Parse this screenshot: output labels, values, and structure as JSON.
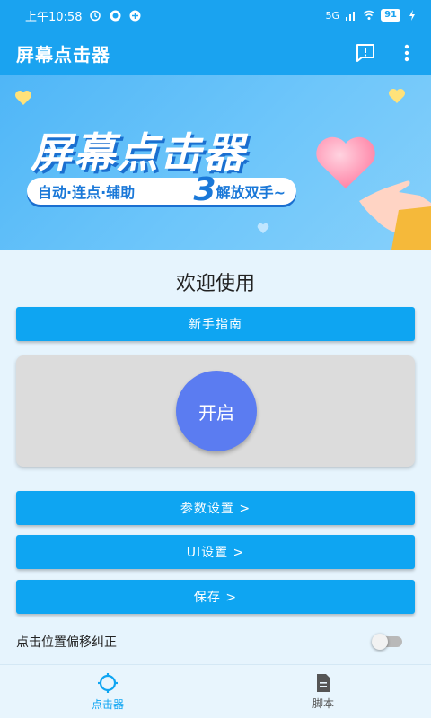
{
  "status_bar": {
    "time": "上午10:58",
    "network": "5G",
    "battery": "91"
  },
  "app_bar": {
    "title": "屏幕点击器"
  },
  "banner": {
    "title": "屏幕点击器",
    "subtitle_left": "自动·连点·辅助",
    "subtitle_num": "3",
    "subtitle_right": "解放双手~"
  },
  "main": {
    "welcome": "欢迎使用",
    "guide_button": "新手指南",
    "start_button": "开启",
    "params_button": "参数设置 >",
    "ui_button": "UI设置 >",
    "save_button": "保存 >",
    "offset_label": "点击位置偏移纠正",
    "offset_enabled": false
  },
  "bottom_nav": {
    "items": [
      {
        "label": "点击器",
        "icon": "crosshair-icon",
        "active": true
      },
      {
        "label": "脚本",
        "icon": "document-icon",
        "active": false
      }
    ]
  },
  "colors": {
    "primary": "#1aa3f0",
    "button": "#0ea5f2",
    "start": "#5b7cf1",
    "background": "#e6f4fd"
  }
}
